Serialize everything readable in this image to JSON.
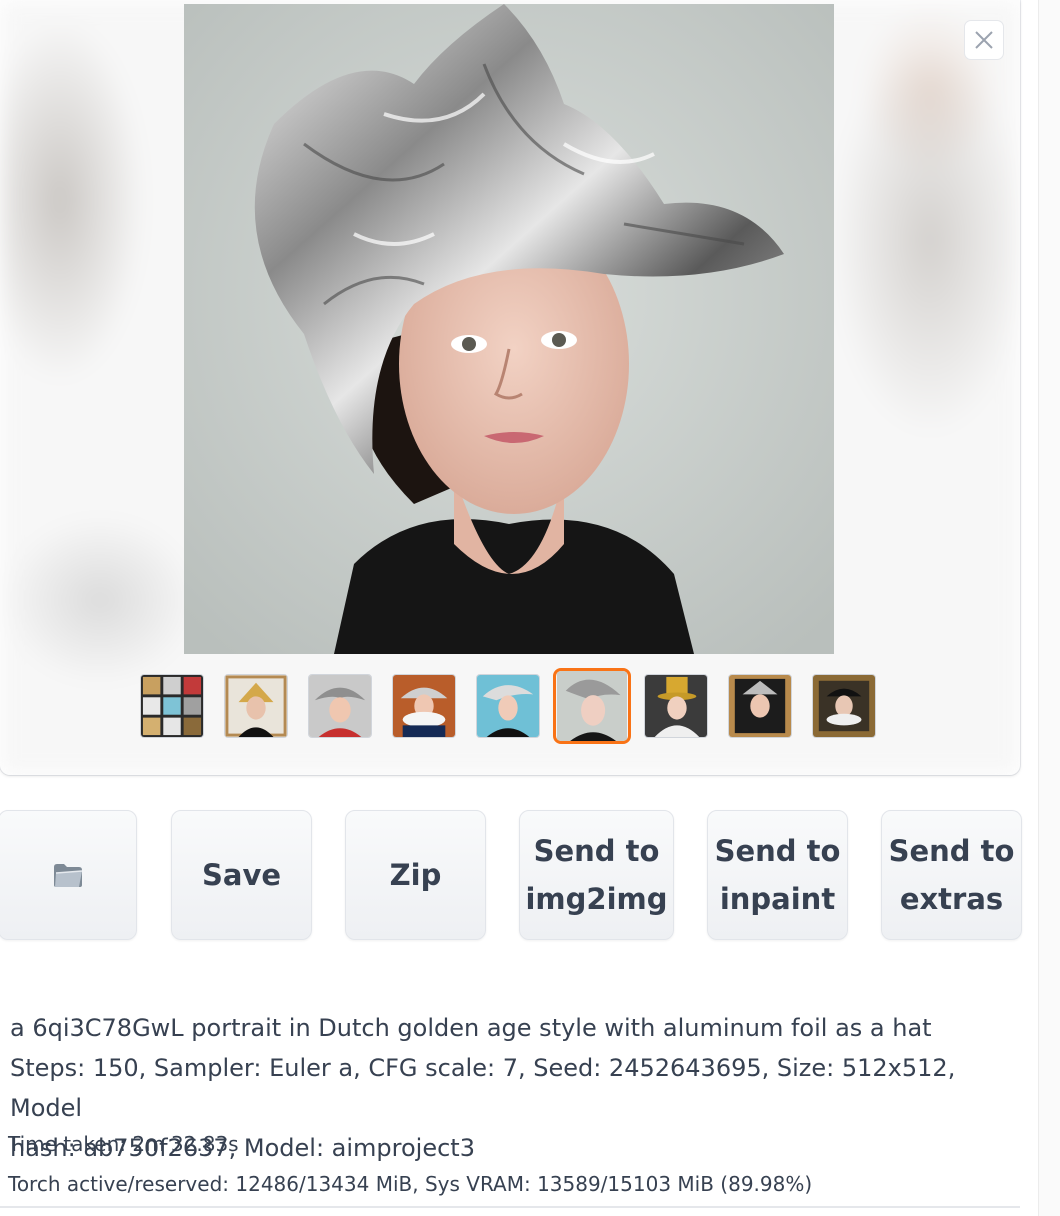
{
  "gallery": {
    "close_icon": "close-icon",
    "thumbnails": [
      {
        "name": "thumb-grid",
        "selected": false
      },
      {
        "name": "thumb-gold-hat",
        "selected": false
      },
      {
        "name": "thumb-silver-red",
        "selected": false
      },
      {
        "name": "thumb-ruff-blue",
        "selected": false
      },
      {
        "name": "thumb-teal-bg",
        "selected": false
      },
      {
        "name": "thumb-foil-hat",
        "selected": true
      },
      {
        "name": "thumb-gold-top",
        "selected": false
      },
      {
        "name": "thumb-gold-frame",
        "selected": false
      },
      {
        "name": "thumb-framed-portrait",
        "selected": false
      }
    ],
    "accent_color": "#f97316"
  },
  "buttons": {
    "folder_icon": "folder-icon",
    "save_label": "Save",
    "zip_label": "Zip",
    "img2img_label": "Send to\nimg2img",
    "inpaint_label": "Send to\ninpaint",
    "extras_label": "Send to\nextras"
  },
  "info": {
    "prompt": "a 6qi3C78GwL portrait in Dutch golden age style with aluminum foil as a hat",
    "params_line1": "Steps: 150, Sampler: Euler a, CFG scale: 7, Seed: 2452643695, Size: 512x512, Model",
    "params_line2": "hash: ab750f2637, Model: aimproject3",
    "time_taken": "Time taken: 2m 32.83s",
    "vram": "Torch active/reserved: 12486/13434 MiB, Sys VRAM: 13589/15103 MiB (89.98%)"
  }
}
